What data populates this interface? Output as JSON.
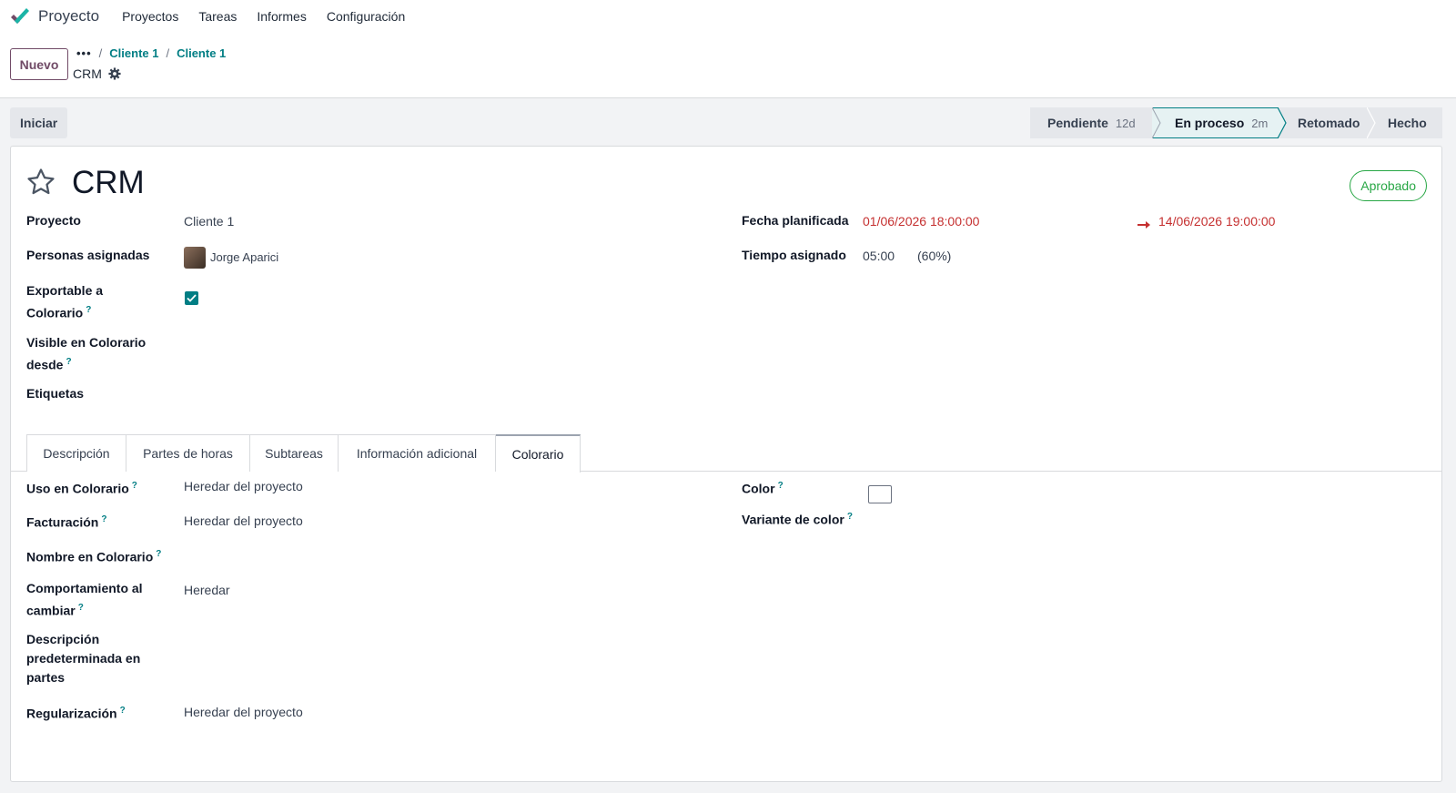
{
  "nav": {
    "app_title": "Proyecto",
    "menu": [
      "Proyectos",
      "Tareas",
      "Informes",
      "Configuración"
    ]
  },
  "control": {
    "new_label": "Nuevo",
    "breadcrumb_dots": "•••",
    "breadcrumb": [
      "Cliente 1",
      "Cliente 1"
    ],
    "record_name": "CRM"
  },
  "statusbar": {
    "start_label": "Iniciar",
    "stages": [
      {
        "label": "Pendiente",
        "duration": "12d",
        "active": false
      },
      {
        "label": "En proceso",
        "duration": "2m",
        "active": true
      },
      {
        "label": "Retomado",
        "duration": "",
        "active": false
      },
      {
        "label": "Hecho",
        "duration": "",
        "active": false
      }
    ]
  },
  "form": {
    "title": "CRM",
    "badge": "Aprobado",
    "fields_left": {
      "project_label": "Proyecto",
      "project_value": "Cliente 1",
      "assignees_label": "Personas asignadas",
      "assignee_value": "Jorge Aparici",
      "exportable_label_1": "Exportable a",
      "exportable_label_2": "Colorario",
      "exportable_checked": true,
      "visible_label_1": "Visible en Colorario",
      "visible_label_2": "desde",
      "tags_label": "Etiquetas"
    },
    "fields_right": {
      "planned_label": "Fecha planificada",
      "planned_start": "01/06/2026 18:00:00",
      "planned_end": "14/06/2026 19:00:00",
      "allocated_label": "Tiempo asignado",
      "allocated_value": "05:00",
      "allocated_pct": "(60%)"
    },
    "help_mark": "?",
    "tabs": [
      "Descripción",
      "Partes de horas",
      "Subtareas",
      "Información adicional",
      "Colorario"
    ],
    "active_tab": "Colorario",
    "colorario": {
      "uso_label": "Uso en Colorario",
      "uso_value": "Heredar del proyecto",
      "facturacion_label": "Facturación",
      "facturacion_value": "Heredar del proyecto",
      "nombre_label": "Nombre en Colorario",
      "comportamiento_label_1": "Comportamiento al",
      "comportamiento_label_2": "cambiar",
      "comportamiento_value": "Heredar",
      "descripcion_label_1": "Descripción",
      "descripcion_label_2": "predeterminada en",
      "descripcion_label_3": "partes",
      "regularizacion_label": "Regularización",
      "regularizacion_value": "Heredar del proyecto",
      "color_label": "Color",
      "variante_label": "Variante de color"
    }
  },
  "colors": {
    "brand": "#714b67",
    "link": "#017e84",
    "danger": "#c53030",
    "success": "#28a745"
  }
}
